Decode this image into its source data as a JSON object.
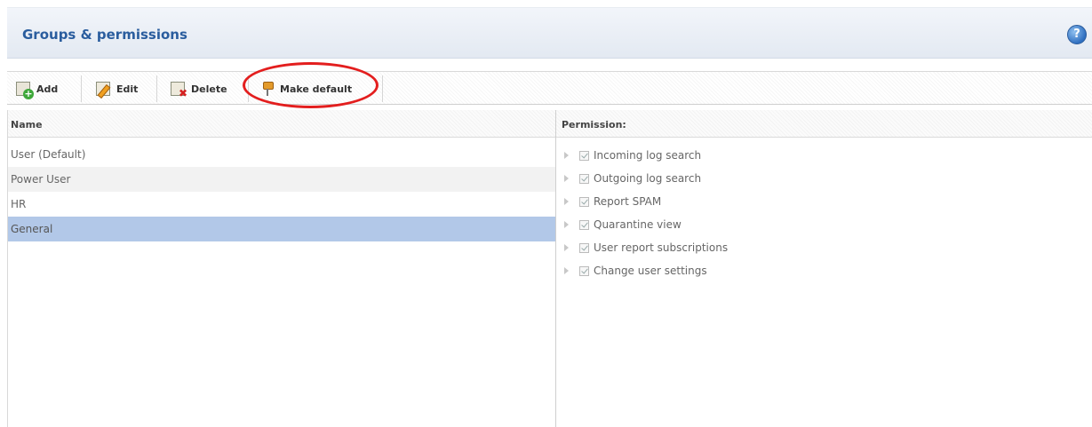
{
  "header": {
    "title": "Groups & permissions",
    "help_glyph": "?"
  },
  "toolbar": {
    "add_label": "Add",
    "edit_label": "Edit",
    "delete_label": "Delete",
    "make_default_label": "Make default"
  },
  "icons": [
    "add-icon",
    "edit-icon",
    "delete-icon",
    "pin-icon",
    "help-icon",
    "expand-arrow-icon",
    "checkbox-icon"
  ],
  "colors": {
    "title": "#2a5d9e",
    "selected_row": "#b2c8e8",
    "highlight_circle": "#e31e1e"
  },
  "groups": {
    "column_header": "Name",
    "rows": [
      "User (Default)",
      "Power User",
      "HR",
      "General"
    ],
    "selected": "General"
  },
  "permissions": {
    "column_header": "Permission:",
    "items": [
      {
        "label": "Incoming log search",
        "checked": true
      },
      {
        "label": "Outgoing log search",
        "checked": true
      },
      {
        "label": "Report SPAM",
        "checked": true
      },
      {
        "label": "Quarantine view",
        "checked": true
      },
      {
        "label": "User report subscriptions",
        "checked": true
      },
      {
        "label": "Change user settings",
        "checked": true
      }
    ]
  }
}
